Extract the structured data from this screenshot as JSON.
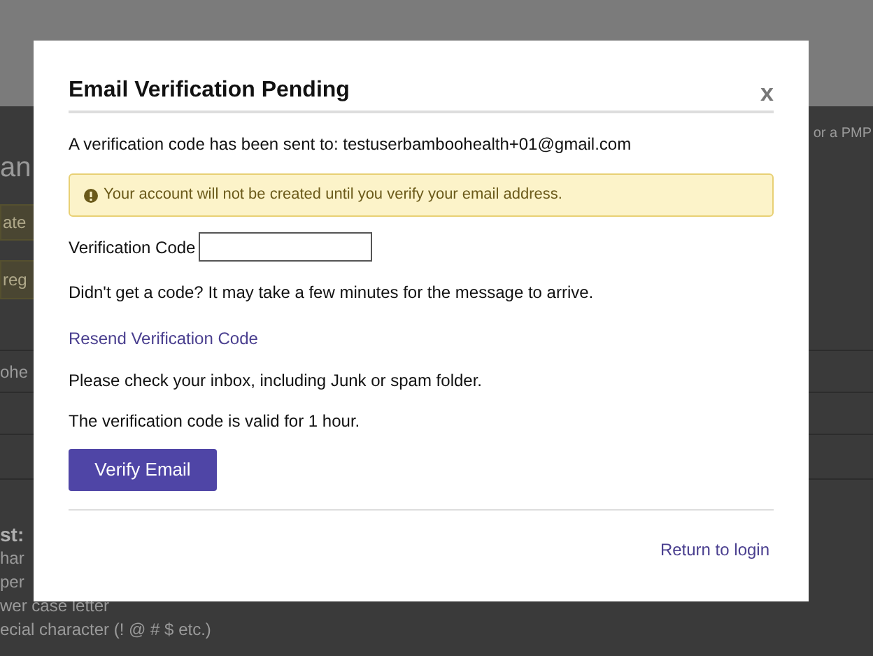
{
  "background_page": {
    "heading": "an",
    "top_right_link": "or a PMP",
    "notices": [
      "ate",
      "reg"
    ],
    "field_fragment": "ohe",
    "list_title": "st:",
    "list_items": [
      "har",
      "per",
      "wer case letter",
      "ecial character (! @ # $ etc.)"
    ]
  },
  "dialog": {
    "title": "Email Verification Pending",
    "close": "x",
    "sent_to": "A verification code has been sent to: testuserbamboohealth+01@gmail.com",
    "alert": "Your account will not be created until you verify your email address.",
    "code_label": "Verification Code",
    "help": "Didn't get a code? It may take a few minutes for the message to arrive.",
    "resend_link": "Resend Verification Code",
    "inbox_note": "Please check your inbox, including Junk or spam folder.",
    "validity_note": "The verification code is valid for 1 hour.",
    "verify_button": "Verify Email",
    "return_link": "Return to login"
  }
}
